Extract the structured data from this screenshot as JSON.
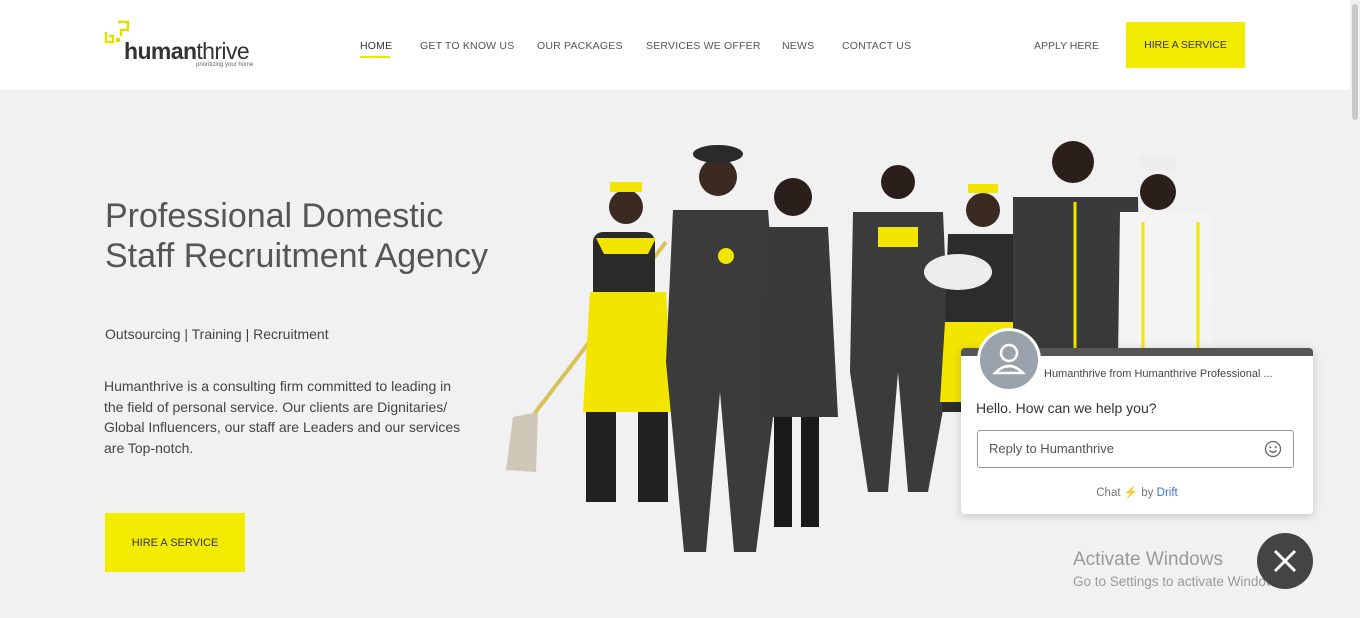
{
  "brand": {
    "name_bold": "human",
    "name_light": "thrive",
    "tagline": "prioritizing your home"
  },
  "nav": {
    "items": [
      "HOME",
      "GET TO KNOW US",
      "OUR PACKAGES",
      "SERVICES WE OFFER",
      "NEWS",
      "CONTACT US"
    ],
    "active": "HOME",
    "apply_label": "APPLY HERE",
    "hire_label": "HIRE A SERVICE"
  },
  "hero": {
    "title": "Professional Domestic Staff Recruitment Agency",
    "subtitle": "Outsourcing | Training | Recruitment",
    "description": "Humanthrive is a consulting firm committed to leading in the field of personal service. Our clients are Dignitaries/ Global Influencers, our staff are Leaders and our services are Top-notch.",
    "cta_label": "HIRE A SERVICE"
  },
  "chat": {
    "from": "Humanthrive from Humanthrive Professional ...",
    "message": "Hello. How can we help you?",
    "input_placeholder": "Reply to Humanthrive",
    "powered_prefix": "Chat",
    "powered_by": "by",
    "powered_brand": "Drift"
  },
  "os_watermark": {
    "title": "Activate Windows",
    "subtitle": "Go to Settings to activate Windows."
  },
  "icons": {
    "logo": "humanthrive-logo-icon",
    "avatar": "user-avatar-icon",
    "emoji": "smiley-icon",
    "bolt": "lightning-icon",
    "close": "close-icon"
  },
  "colors": {
    "accent": "#f2ec00",
    "hero_bg": "#f1f1f1",
    "text": "#555555",
    "chat_link": "#3a74d9",
    "close_button": "#444444"
  }
}
